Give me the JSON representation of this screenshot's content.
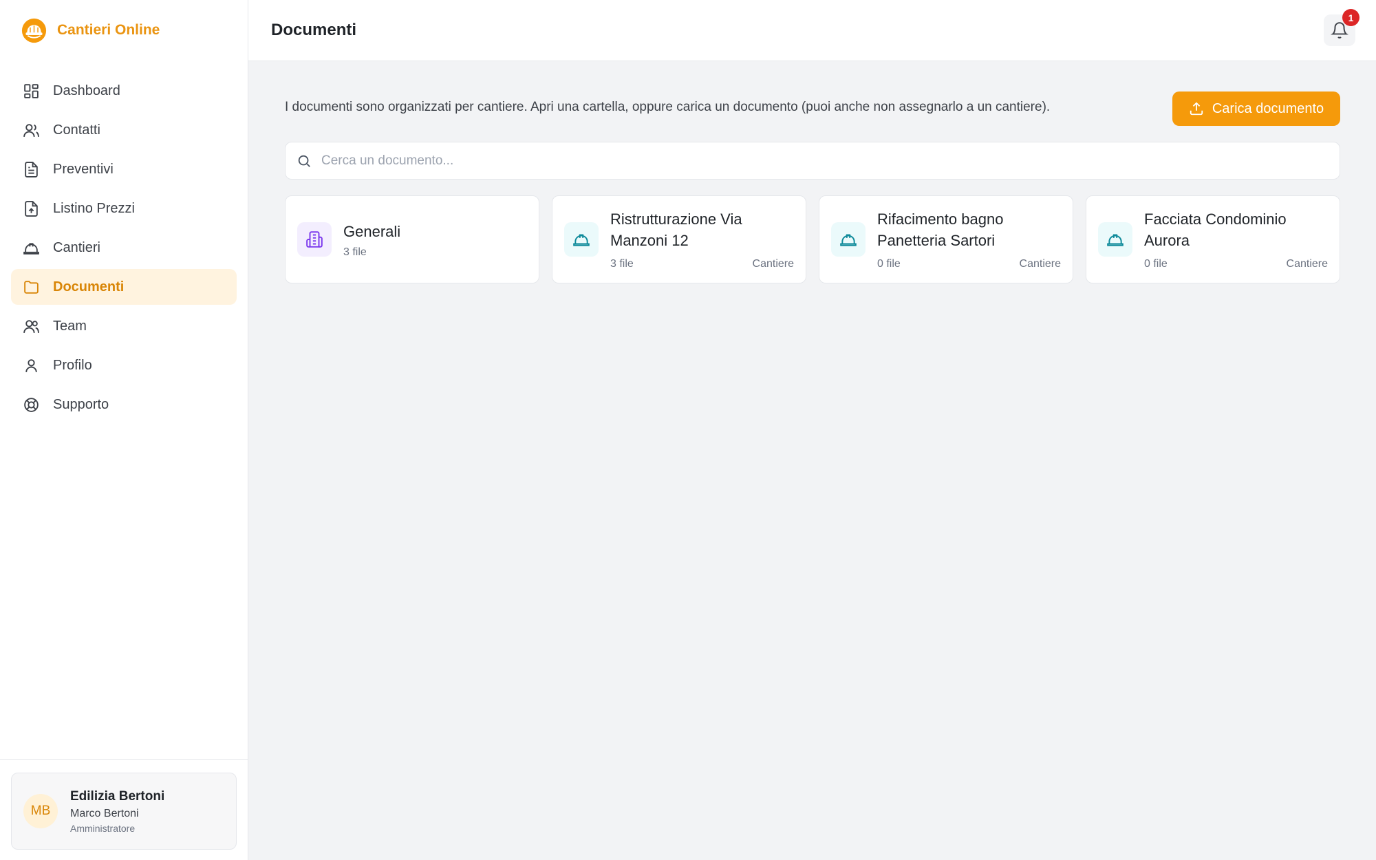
{
  "app": {
    "name": "Cantieri Online",
    "accent_color": "#f59a0b",
    "logo_icon": "hard-hat-logo"
  },
  "sidebar": {
    "items": [
      {
        "label": "Dashboard",
        "icon": "dashboard-icon",
        "active": false
      },
      {
        "label": "Contatti",
        "icon": "users-icon",
        "active": false
      },
      {
        "label": "Preventivi",
        "icon": "file-text-icon",
        "active": false
      },
      {
        "label": "Listino Prezzi",
        "icon": "file-upload-icon",
        "active": false
      },
      {
        "label": "Cantieri",
        "icon": "hard-hat-icon",
        "active": false
      },
      {
        "label": "Documenti",
        "icon": "folder-icon",
        "active": true
      },
      {
        "label": "Team",
        "icon": "team-icon",
        "active": false
      },
      {
        "label": "Profilo",
        "icon": "user-icon",
        "active": false
      },
      {
        "label": "Supporto",
        "icon": "lifebuoy-icon",
        "active": false
      }
    ],
    "user": {
      "initials": "MB",
      "company": "Edilizia Bertoni",
      "name": "Marco Bertoni",
      "role": "Amministratore"
    }
  },
  "header": {
    "title": "Documenti",
    "notifications_count": "1",
    "bell_icon": "bell-icon"
  },
  "main": {
    "intro": "I documenti sono organizzati per cantiere. Apri una cartella, oppure carica un documento (puoi anche non assegnarlo a un cantiere).",
    "upload_label": "Carica documento",
    "search": {
      "placeholder": "Cerca un documento...",
      "value": ""
    },
    "folders": [
      {
        "name": "Generali",
        "count": "3 file",
        "type": "",
        "icon": "building-icon",
        "icon_color": "#7c3aed"
      },
      {
        "name": "Ristrutturazione Via Manzoni 12",
        "count": "3 file",
        "type": "Cantiere",
        "icon": "hard-hat-icon",
        "icon_color": "#0e8a9a"
      },
      {
        "name": "Rifacimento bagno Panetteria Sartori",
        "count": "0 file",
        "type": "Cantiere",
        "icon": "hard-hat-icon",
        "icon_color": "#0e8a9a"
      },
      {
        "name": "Facciata Condominio Aurora",
        "count": "0 file",
        "type": "Cantiere",
        "icon": "hard-hat-icon",
        "icon_color": "#0e8a9a"
      }
    ]
  }
}
